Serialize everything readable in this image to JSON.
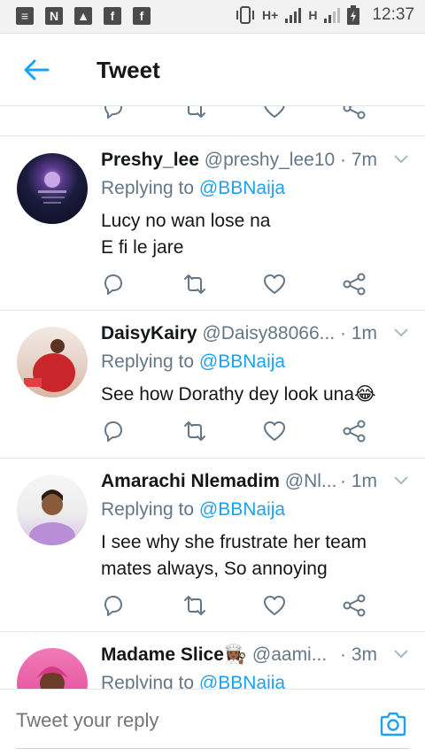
{
  "status_bar": {
    "left_icons": [
      "notification-icon",
      "n-app-icon",
      "image-icon",
      "facebook-icon",
      "facebook-icon"
    ],
    "network_1": "H+",
    "network_2": "H",
    "time": "12:37"
  },
  "header": {
    "title": "Tweet"
  },
  "tweets": [
    {
      "name": "Preshy_lee",
      "handle": "@preshy_lee10",
      "time": "· 7m",
      "replying_prefix": "Replying to",
      "replying_to": "@BBNaija",
      "lines": [
        "Lucy no wan lose na",
        "E fi le jare"
      ]
    },
    {
      "name": "DaisyKairy",
      "handle": "@Daisy88066...",
      "time": "· 1m",
      "replying_prefix": "Replying to",
      "replying_to": "@BBNaija",
      "lines": [
        "See how Dorathy dey look una😂"
      ]
    },
    {
      "name": "Amarachi Nlemadim",
      "handle": "@Nl...",
      "time": "· 1m",
      "replying_prefix": "Replying to",
      "replying_to": "@BBNaija",
      "lines": [
        "I see why she frustrate her team",
        "mates always, So annoying"
      ]
    },
    {
      "name": "Madame Slice👩🏾‍🍳",
      "handle": "@aami...",
      "time": "· 3m",
      "replying_prefix": "Replying to",
      "replying_to": "@BBNaija",
      "lines": []
    }
  ],
  "reply_bar": {
    "placeholder": "Tweet your reply"
  },
  "colors": {
    "accent": "#1da1f2",
    "secondary_text": "#657786",
    "divider": "#e1e8ed",
    "icon": "#657786"
  }
}
